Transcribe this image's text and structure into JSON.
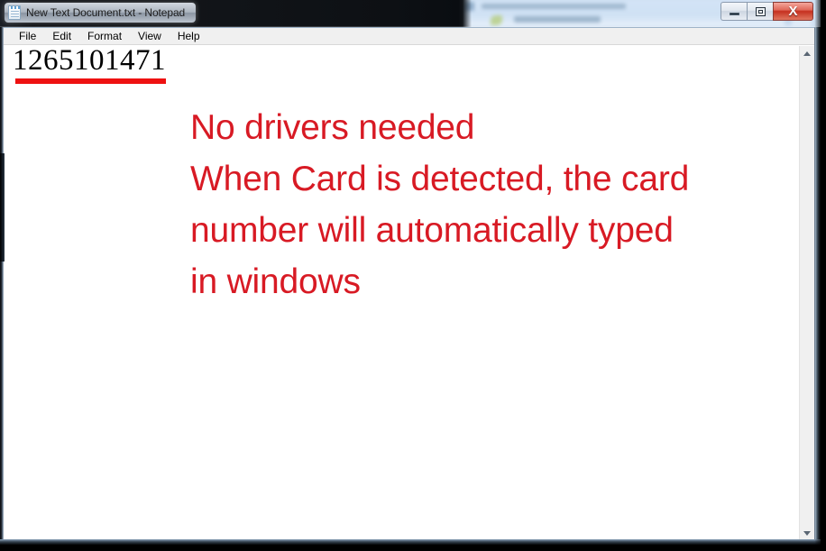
{
  "window": {
    "title": "New Text Document.txt - Notepad",
    "icon": "notepad-icon",
    "controls": {
      "minimize_label": "–",
      "restore_label": "□",
      "close_label": "X"
    }
  },
  "menubar": {
    "items": [
      {
        "label": "File"
      },
      {
        "label": "Edit"
      },
      {
        "label": "Format"
      },
      {
        "label": "View"
      },
      {
        "label": "Help"
      }
    ]
  },
  "document": {
    "card_number": "1265101471",
    "underline_color": "#ee1111"
  },
  "annotation": {
    "color": "#d81a24",
    "lines": [
      "No drivers needed",
      "When Card is detected, the card",
      "number will automatically typed",
      "in windows"
    ]
  },
  "scrollbar": {
    "up_arrow": "scroll-up-arrow",
    "down_arrow": "scroll-down-arrow"
  }
}
